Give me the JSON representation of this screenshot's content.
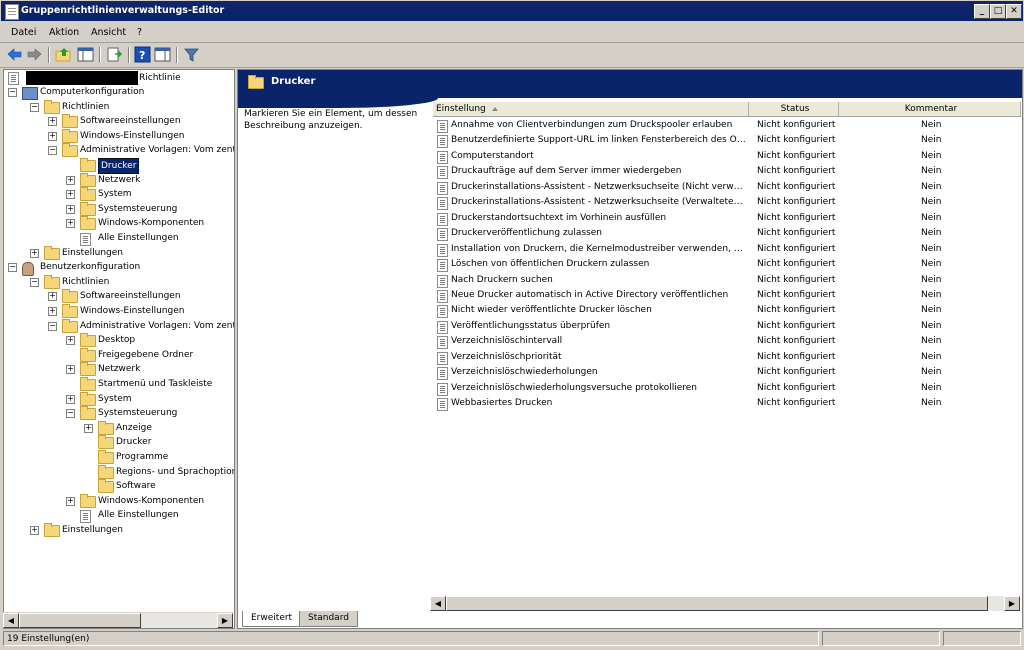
{
  "window": {
    "title": "Gruppenrichtlinienverwaltungs-Editor",
    "buttons": [
      "_",
      "□",
      "✕"
    ]
  },
  "menu": [
    {
      "label": "Datei",
      "underline": "D"
    },
    {
      "label": "Aktion",
      "underline": "k"
    },
    {
      "label": "Ansicht",
      "underline": "A"
    },
    {
      "label": "?",
      "underline": "?"
    }
  ],
  "toolbar": {
    "icons": [
      "back-arrow-icon",
      "forward-arrow-icon",
      "up-folder-icon",
      "show-hide-tree-icon",
      "export-list-icon",
      "help-icon",
      "action-pane-icon",
      "filter-icon"
    ],
    "colors": {
      "back": "#2c6fd6",
      "forward": "#2c6fd6",
      "filter": "#4a7ab0",
      "help": "#1b4fb4"
    }
  },
  "tree": {
    "root_label": "Richtlinie",
    "items": [
      {
        "label": "Computerkonfiguration",
        "icon": "computer-icon",
        "expander": "−"
      },
      {
        "label": "Richtlinien",
        "icon": "folder-icon",
        "expander": "−"
      },
      {
        "label": "Softwareeinstellungen",
        "icon": "folder-icon",
        "expander": "+"
      },
      {
        "label": "Windows-Einstellungen",
        "icon": "folder-icon",
        "expander": "+"
      },
      {
        "label": "Administrative Vorlagen: Vom zentra",
        "icon": "folder-icon",
        "expander": "−"
      },
      {
        "label": "Drucker",
        "icon": "folder-icon",
        "expander": "",
        "selected": true
      },
      {
        "label": "Netzwerk",
        "icon": "folder-icon",
        "expander": "+"
      },
      {
        "label": "System",
        "icon": "folder-icon",
        "expander": "+"
      },
      {
        "label": "Systemsteuerung",
        "icon": "folder-icon",
        "expander": "+"
      },
      {
        "label": "Windows-Komponenten",
        "icon": "folder-icon",
        "expander": "+"
      },
      {
        "label": "Alle Einstellungen",
        "icon": "policy-folder-icon",
        "expander": ""
      },
      {
        "label": "Einstellungen",
        "icon": "folder-icon",
        "expander": "+"
      },
      {
        "label": "Benutzerkonfiguration",
        "icon": "user-icon",
        "expander": "−"
      },
      {
        "label": "Richtlinien",
        "icon": "folder-icon",
        "expander": "−"
      },
      {
        "label": "Softwareeinstellungen",
        "icon": "folder-icon",
        "expander": "+"
      },
      {
        "label": "Windows-Einstellungen",
        "icon": "folder-icon",
        "expander": "+"
      },
      {
        "label": "Administrative Vorlagen: Vom zentr",
        "icon": "folder-icon",
        "expander": "−"
      },
      {
        "label": "Desktop",
        "icon": "folder-icon",
        "expander": "+"
      },
      {
        "label": "Freigegebene Ordner",
        "icon": "folder-icon",
        "expander": ""
      },
      {
        "label": "Netzwerk",
        "icon": "folder-icon",
        "expander": "+"
      },
      {
        "label": "Startmenü und Taskleiste",
        "icon": "folder-icon",
        "expander": ""
      },
      {
        "label": "System",
        "icon": "folder-icon",
        "expander": "+"
      },
      {
        "label": "Systemsteuerung",
        "icon": "folder-icon",
        "expander": "−"
      },
      {
        "label": "Anzeige",
        "icon": "folder-icon",
        "expander": "+"
      },
      {
        "label": "Drucker",
        "icon": "folder-icon",
        "expander": ""
      },
      {
        "label": "Programme",
        "icon": "folder-icon",
        "expander": ""
      },
      {
        "label": "Regions- und Sprachoptione",
        "icon": "folder-icon",
        "expander": ""
      },
      {
        "label": "Software",
        "icon": "folder-icon",
        "expander": ""
      },
      {
        "label": "Windows-Komponenten",
        "icon": "folder-icon",
        "expander": "+"
      },
      {
        "label": "Alle Einstellungen",
        "icon": "policy-folder-icon",
        "expander": ""
      },
      {
        "label": "Einstellungen",
        "icon": "folder-icon",
        "expander": "+"
      }
    ]
  },
  "details": {
    "header_title": "Drucker",
    "description": "Markieren Sie ein Element, um dessen Beschreibung anzuzeigen.",
    "columns": {
      "name": "Einstellung",
      "status": "Status",
      "comment": "Kommentar"
    },
    "rows": [
      {
        "name": "Annahme von Clientverbindungen zum Druckspooler erlauben",
        "status": "Nicht konfiguriert",
        "comment": "Nein"
      },
      {
        "name": "Benutzerdefinierte Support-URL im linken Fensterbereich des Ord...",
        "status": "Nicht konfiguriert",
        "comment": "Nein"
      },
      {
        "name": "Computerstandort",
        "status": "Nicht konfiguriert",
        "comment": "Nein"
      },
      {
        "name": "Druckaufträge auf dem Server immer wiedergeben",
        "status": "Nicht konfiguriert",
        "comment": "Nein"
      },
      {
        "name": "Druckerinstallations-Assistent - Netzwerksuchseite (Nicht verwalt...",
        "status": "Nicht konfiguriert",
        "comment": "Nein"
      },
      {
        "name": "Druckerinstallations-Assistent - Netzwerksuchseite (Verwaltetes ...",
        "status": "Nicht konfiguriert",
        "comment": "Nein"
      },
      {
        "name": "Druckerstandortsuchtext im Vorhinein ausfüllen",
        "status": "Nicht konfiguriert",
        "comment": "Nein"
      },
      {
        "name": "Druckerveröffentlichung zulassen",
        "status": "Nicht konfiguriert",
        "comment": "Nein"
      },
      {
        "name": "Installation von Druckern, die Kernelmodustreiber verwenden, nic...",
        "status": "Nicht konfiguriert",
        "comment": "Nein"
      },
      {
        "name": "Löschen von öffentlichen Druckern zulassen",
        "status": "Nicht konfiguriert",
        "comment": "Nein"
      },
      {
        "name": "Nach Druckern suchen",
        "status": "Nicht konfiguriert",
        "comment": "Nein"
      },
      {
        "name": "Neue Drucker automatisch in Active Directory veröffentlichen",
        "status": "Nicht konfiguriert",
        "comment": "Nein"
      },
      {
        "name": "Nicht wieder veröffentlichte Drucker löschen",
        "status": "Nicht konfiguriert",
        "comment": "Nein"
      },
      {
        "name": "Veröffentlichungsstatus überprüfen",
        "status": "Nicht konfiguriert",
        "comment": "Nein"
      },
      {
        "name": "Verzeichnislöschintervall",
        "status": "Nicht konfiguriert",
        "comment": "Nein"
      },
      {
        "name": "Verzeichnislöschpriorität",
        "status": "Nicht konfiguriert",
        "comment": "Nein"
      },
      {
        "name": "Verzeichnislöschwiederholungen",
        "status": "Nicht konfiguriert",
        "comment": "Nein"
      },
      {
        "name": "Verzeichnislöschwiederholungsversuche protokollieren",
        "status": "Nicht konfiguriert",
        "comment": "Nein"
      },
      {
        "name": "Webbasiertes Drucken",
        "status": "Nicht konfiguriert",
        "comment": "Nein"
      }
    ]
  },
  "tabs": [
    {
      "label": "Erweitert",
      "active": true
    },
    {
      "label": "Standard",
      "active": false
    }
  ],
  "statusbar": {
    "text": "19 Einstellung(en)"
  }
}
